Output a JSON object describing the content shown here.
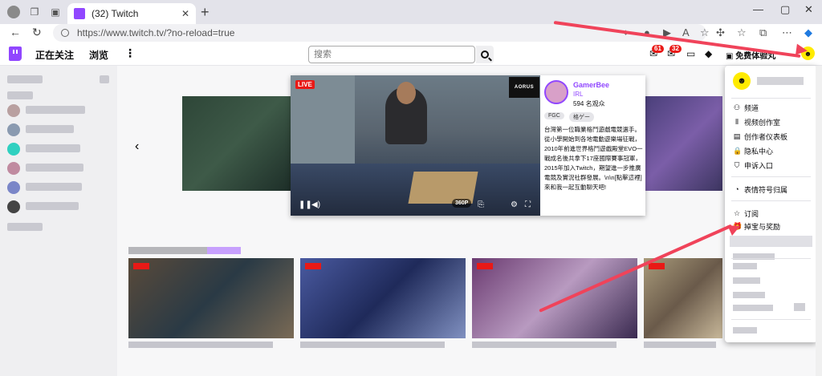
{
  "browser": {
    "tab_title": "(32) Twitch",
    "url": "https://www.twitch.tv/?no-reload=true"
  },
  "nav": {
    "following": "正在关注",
    "browse": "浏览",
    "more": "⋮",
    "search_placeholder": "搜索",
    "badge_1": "61",
    "badge_2": "32",
    "prime_label": "免费体验丸"
  },
  "featured": {
    "live": "LIVE",
    "sponsor": "AORUS",
    "quality": "360P",
    "streamer": "GamerBee",
    "game": "IRL",
    "viewers": "594 名观众",
    "tags": [
      "FGC",
      "格ゲー"
    ],
    "description": "台灣第一位職業格鬥遊戲電競選手。從小學開始到各地電動遊樂場征戰，2010年前進世界格鬥遊戲殿堂EVO一戰成名後共拿下17座國際賽事冠軍，2015年加入Twitch，期望進一步推廣電競及實況社群發展。\\n\\n[點擊這裡] 來和我一起互動聊天吧!"
  },
  "menu": {
    "items": [
      {
        "icon": "channel-icon",
        "glyph": "⚇",
        "label": "频道"
      },
      {
        "icon": "studio-icon",
        "glyph": "⫴",
        "label": "视频创作室"
      },
      {
        "icon": "dashboard-icon",
        "glyph": "▤",
        "label": "创作者仪表板"
      },
      {
        "icon": "lock-icon",
        "glyph": "🔒",
        "label": "隐私中心"
      },
      {
        "icon": "shield-icon",
        "glyph": "⛉",
        "label": "申诉入口"
      },
      {
        "icon": "emote-icon",
        "glyph": "◔",
        "label": "表情符号归属"
      },
      {
        "icon": "star-icon",
        "glyph": "☆",
        "label": "订阅"
      },
      {
        "icon": "drops-icon",
        "glyph": "🎁",
        "label": "掉宝与奖励"
      }
    ]
  },
  "colors": {
    "brand": "#9147ff",
    "live_red": "#e91916",
    "annotation_arrow": "#f0435a",
    "avatar_yellow": "#ffeb00"
  }
}
